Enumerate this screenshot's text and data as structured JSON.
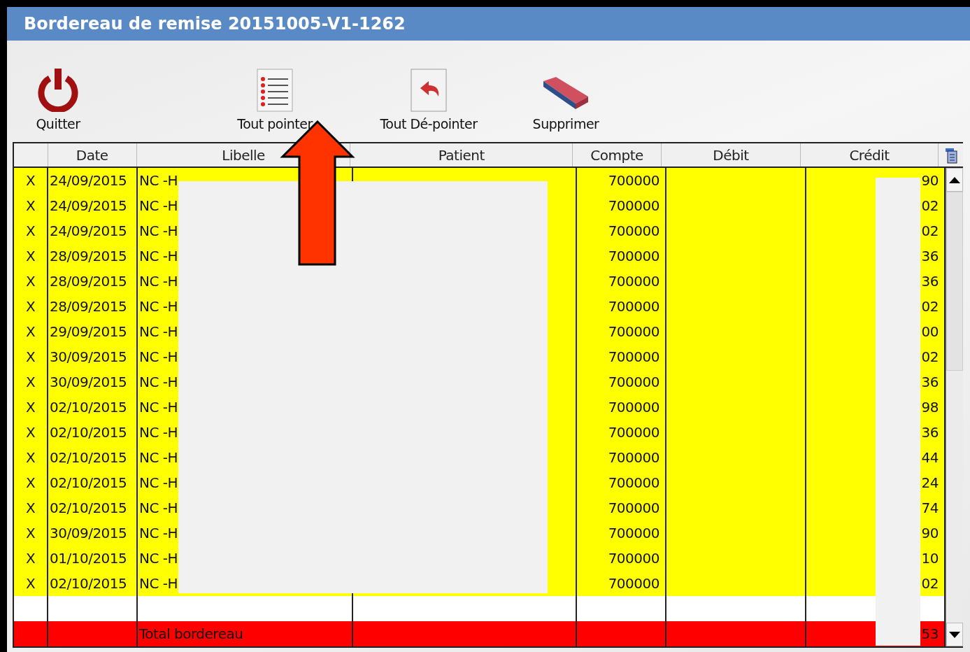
{
  "window": {
    "title": "Bordereau de remise 20151005-V1-1262"
  },
  "toolbar": [
    {
      "kind": "power",
      "label": "Quitter"
    },
    {
      "kind": "list",
      "label": "Tout pointer"
    },
    {
      "kind": "undo",
      "label": "Tout Dé-pointer"
    },
    {
      "kind": "eraser",
      "label": "Supprimer"
    }
  ],
  "table": {
    "columns": [
      "",
      "Date",
      "Libelle",
      "Patient",
      "Compte",
      "Débit",
      "Crédit"
    ],
    "rows": [
      {
        "mark": "X",
        "date": "24/09/2015",
        "libelle": "NC -H",
        "compte": "700000",
        "credit": "90"
      },
      {
        "mark": "X",
        "date": "24/09/2015",
        "libelle": "NC -H",
        "compte": "700000",
        "credit": "02"
      },
      {
        "mark": "X",
        "date": "24/09/2015",
        "libelle": "NC -H",
        "compte": "700000",
        "credit": "02"
      },
      {
        "mark": "X",
        "date": "28/09/2015",
        "libelle": "NC -H",
        "compte": "700000",
        "credit": "36"
      },
      {
        "mark": "X",
        "date": "28/09/2015",
        "libelle": "NC -H",
        "compte": "700000",
        "credit": "36"
      },
      {
        "mark": "X",
        "date": "28/09/2015",
        "libelle": "NC -H",
        "compte": "700000",
        "credit": "02"
      },
      {
        "mark": "X",
        "date": "29/09/2015",
        "libelle": "NC -H",
        "compte": "700000",
        "credit": "00"
      },
      {
        "mark": "X",
        "date": "30/09/2015",
        "libelle": "NC -H",
        "compte": "700000",
        "credit": "02"
      },
      {
        "mark": "X",
        "date": "30/09/2015",
        "libelle": "NC -H",
        "compte": "700000",
        "credit": "36"
      },
      {
        "mark": "X",
        "date": "02/10/2015",
        "libelle": "NC -H",
        "compte": "700000",
        "credit": "98"
      },
      {
        "mark": "X",
        "date": "02/10/2015",
        "libelle": "NC -H",
        "compte": "700000",
        "credit": "36"
      },
      {
        "mark": "X",
        "date": "02/10/2015",
        "libelle": "NC -H",
        "compte": "700000",
        "credit": "44"
      },
      {
        "mark": "X",
        "date": "02/10/2015",
        "libelle": "NC -H",
        "compte": "700000",
        "credit": "24"
      },
      {
        "mark": "X",
        "date": "02/10/2015",
        "libelle": "NC -H",
        "compte": "700000",
        "credit": "74"
      },
      {
        "mark": "X",
        "date": "30/09/2015",
        "libelle": "NC -H",
        "compte": "700000",
        "credit": "90"
      },
      {
        "mark": "X",
        "date": "01/10/2015",
        "libelle": "NC -H",
        "compte": "700000",
        "credit": "10"
      },
      {
        "mark": "X",
        "date": "02/10/2015",
        "libelle": "NC -H",
        "compte": "700000",
        "credit": "02"
      }
    ],
    "total": {
      "libelle": "Total bordereau",
      "credit": "53"
    }
  }
}
